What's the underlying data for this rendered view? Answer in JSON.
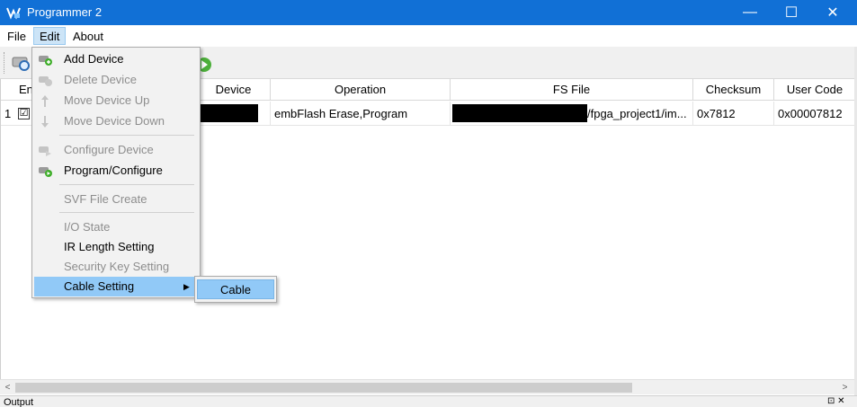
{
  "window": {
    "title": "Programmer 2",
    "controls": {
      "minimize": "—",
      "maximize": "☐",
      "close": "✕"
    }
  },
  "menubar": {
    "file": "File",
    "edit": "Edit",
    "about": "About"
  },
  "table": {
    "headers": [
      "En",
      "Device",
      "Operation",
      "FS File",
      "Checksum",
      "User Code"
    ],
    "rows": [
      {
        "index": "1",
        "enabled": "☑",
        "device": "",
        "operation": "embFlash Erase,Program",
        "fs_file": "/fpga_project1/im...",
        "checksum": "0x7812",
        "user_code": "0x00007812"
      }
    ]
  },
  "edit_menu": {
    "items": [
      {
        "label": "Add Device",
        "enabled": true,
        "icon": "add-device-icon"
      },
      {
        "label": "Delete Device",
        "enabled": false,
        "icon": "delete-device-icon"
      },
      {
        "label": "Move Device Up",
        "enabled": false,
        "icon": "arrow-up-icon"
      },
      {
        "label": "Move Device Down",
        "enabled": false,
        "icon": "arrow-down-icon"
      },
      {
        "label": "Configure Device",
        "enabled": false,
        "icon": "configure-device-icon"
      },
      {
        "label": "Program/Configure",
        "enabled": true,
        "icon": "program-configure-icon"
      },
      {
        "label": "SVF File Create",
        "enabled": false
      },
      {
        "label": "I/O State",
        "enabled": false
      },
      {
        "label": "IR Length Setting",
        "enabled": true
      },
      {
        "label": "Security Key Setting",
        "enabled": false
      },
      {
        "label": "Cable Setting",
        "enabled": true,
        "highlighted": true,
        "has_submenu": true
      }
    ],
    "submenu_arrow": "▶"
  },
  "cable_submenu": {
    "items": [
      {
        "label": "Cable"
      }
    ]
  },
  "scrollbar": {
    "left_arrow": "<",
    "right_arrow": ">"
  },
  "output_dock": {
    "label": "Output",
    "buttons": "⊡ ✕"
  },
  "colors": {
    "titlebar": "#1170d6",
    "menu_highlight": "#91c9f7",
    "disabled_text": "#8d8d8d"
  }
}
